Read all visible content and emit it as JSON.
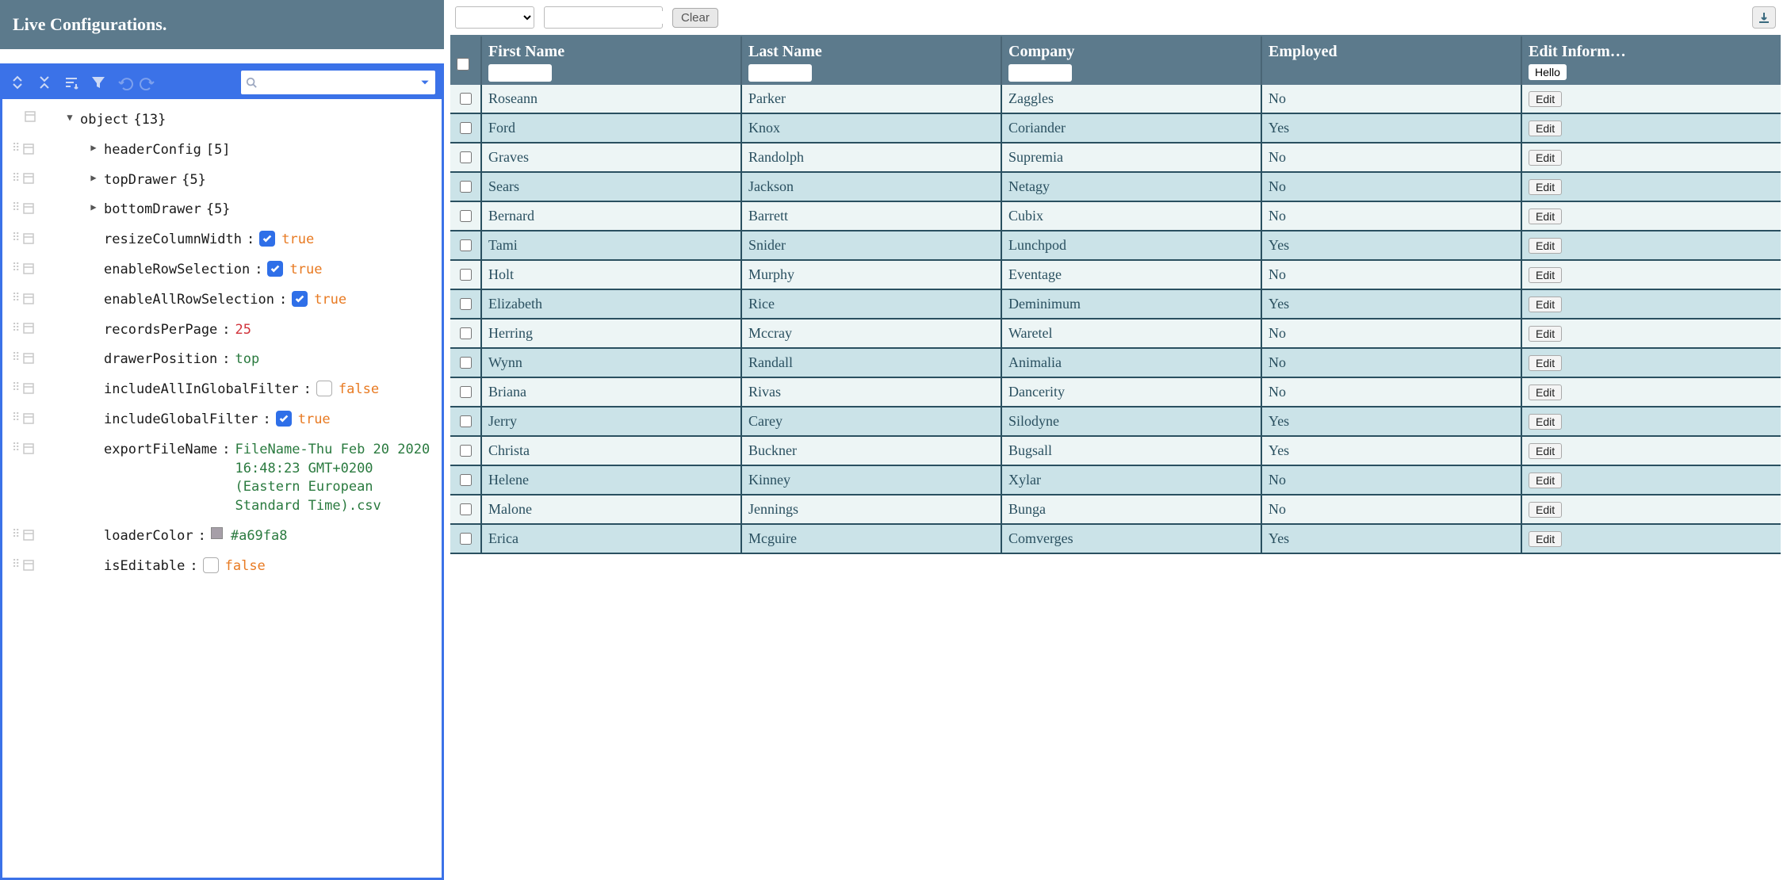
{
  "panel": {
    "title": "Live Configurations."
  },
  "toolbar": {
    "clear_label": "Clear"
  },
  "json_root": {
    "label": "object",
    "count": "{13}"
  },
  "json_nodes": [
    {
      "key": "headerConfig",
      "meta": "[5]",
      "type": "expandable"
    },
    {
      "key": "topDrawer",
      "meta": "{5}",
      "type": "expandable"
    },
    {
      "key": "bottomDrawer",
      "meta": "{5}",
      "type": "expandable"
    },
    {
      "key": "resizeColumnWidth",
      "type": "bool",
      "value": "true",
      "checked": true
    },
    {
      "key": "enableRowSelection",
      "type": "bool",
      "value": "true",
      "checked": true
    },
    {
      "key": "enableAllRowSelection",
      "type": "bool",
      "value": "true",
      "checked": true
    },
    {
      "key": "recordsPerPage",
      "type": "num",
      "value": "25"
    },
    {
      "key": "drawerPosition",
      "type": "ident",
      "value": "top"
    },
    {
      "key": "includeAllInGlobalFilter",
      "type": "bool",
      "value": "false",
      "checked": false
    },
    {
      "key": "includeGlobalFilter",
      "type": "bool",
      "value": "true",
      "checked": true
    },
    {
      "key": "exportFileName",
      "type": "string",
      "value": "FileName-Thu Feb 20 2020 16:48:23 GMT+0200 (Eastern European Standard Time).csv"
    },
    {
      "key": "loaderColor",
      "type": "color",
      "value": "#a69fa8"
    },
    {
      "key": "isEditable",
      "type": "bool",
      "value": "false",
      "checked": false
    }
  ],
  "columns": {
    "firstName": "First Name",
    "lastName": "Last Name",
    "company": "Company",
    "employed": "Employed",
    "edit": "Edit Inform…",
    "hello": "Hello",
    "edit_btn": "Edit"
  },
  "rows": [
    {
      "first": "Roseann",
      "last": "Parker",
      "company": "Zaggles",
      "employed": "No"
    },
    {
      "first": "Ford",
      "last": "Knox",
      "company": "Coriander",
      "employed": "Yes"
    },
    {
      "first": "Graves",
      "last": "Randolph",
      "company": "Supremia",
      "employed": "No"
    },
    {
      "first": "Sears",
      "last": "Jackson",
      "company": "Netagy",
      "employed": "No"
    },
    {
      "first": "Bernard",
      "last": "Barrett",
      "company": "Cubix",
      "employed": "No"
    },
    {
      "first": "Tami",
      "last": "Snider",
      "company": "Lunchpod",
      "employed": "Yes"
    },
    {
      "first": "Holt",
      "last": "Murphy",
      "company": "Eventage",
      "employed": "No"
    },
    {
      "first": "Elizabeth",
      "last": "Rice",
      "company": "Deminimum",
      "employed": "Yes"
    },
    {
      "first": "Herring",
      "last": "Mccray",
      "company": "Waretel",
      "employed": "No"
    },
    {
      "first": "Wynn",
      "last": "Randall",
      "company": "Animalia",
      "employed": "No"
    },
    {
      "first": "Briana",
      "last": "Rivas",
      "company": "Dancerity",
      "employed": "No"
    },
    {
      "first": "Jerry",
      "last": "Carey",
      "company": "Silodyne",
      "employed": "Yes"
    },
    {
      "first": "Christa",
      "last": "Buckner",
      "company": "Bugsall",
      "employed": "Yes"
    },
    {
      "first": "Helene",
      "last": "Kinney",
      "company": "Xylar",
      "employed": "No"
    },
    {
      "first": "Malone",
      "last": "Jennings",
      "company": "Bunga",
      "employed": "No"
    },
    {
      "first": "Erica",
      "last": "Mcguire",
      "company": "Comverges",
      "employed": "Yes"
    }
  ]
}
